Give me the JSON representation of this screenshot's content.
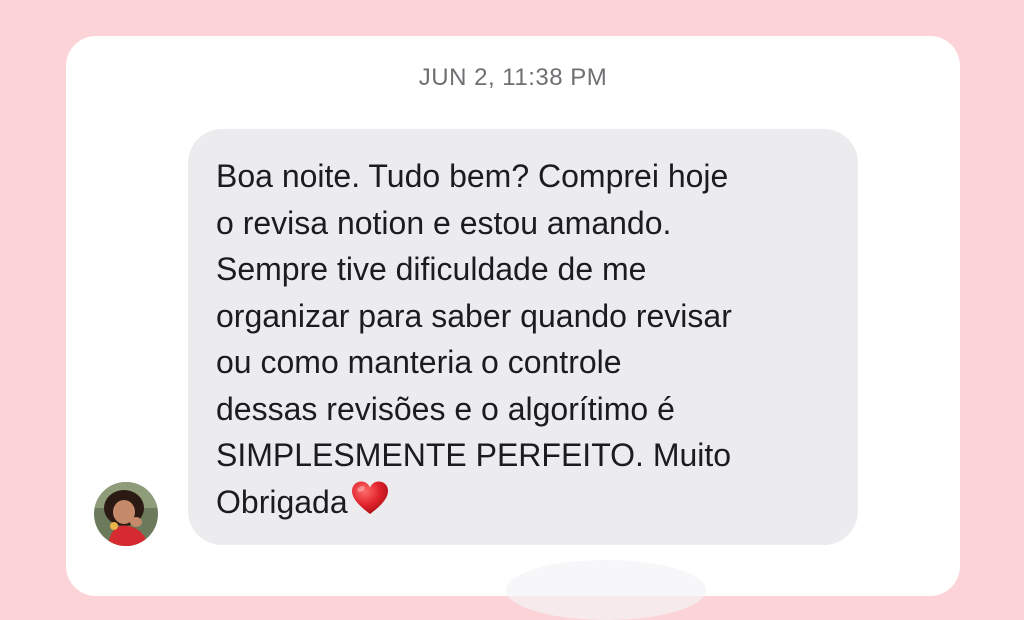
{
  "conversation": {
    "timestamp": "JUN 2, 11:38 PM"
  },
  "message": {
    "lines": [
      "Boa noite. Tudo bem? Comprei hoje",
      "o revisa notion e estou amando.",
      "Sempre tive dificuldade de me",
      "organizar para saber quando revisar",
      "ou como manteria o controle",
      "dessas revisões e o algorítimo é",
      "SIMPLESMENTE PERFEITO. Muito",
      "Obrigada"
    ],
    "emoji": "heart-icon"
  },
  "sender": {
    "avatar": "avatar-photo"
  },
  "colors": {
    "background": "#fcd3d6",
    "card": "#ffffff",
    "bubble": "#ececee",
    "heart": "#e0242c"
  }
}
